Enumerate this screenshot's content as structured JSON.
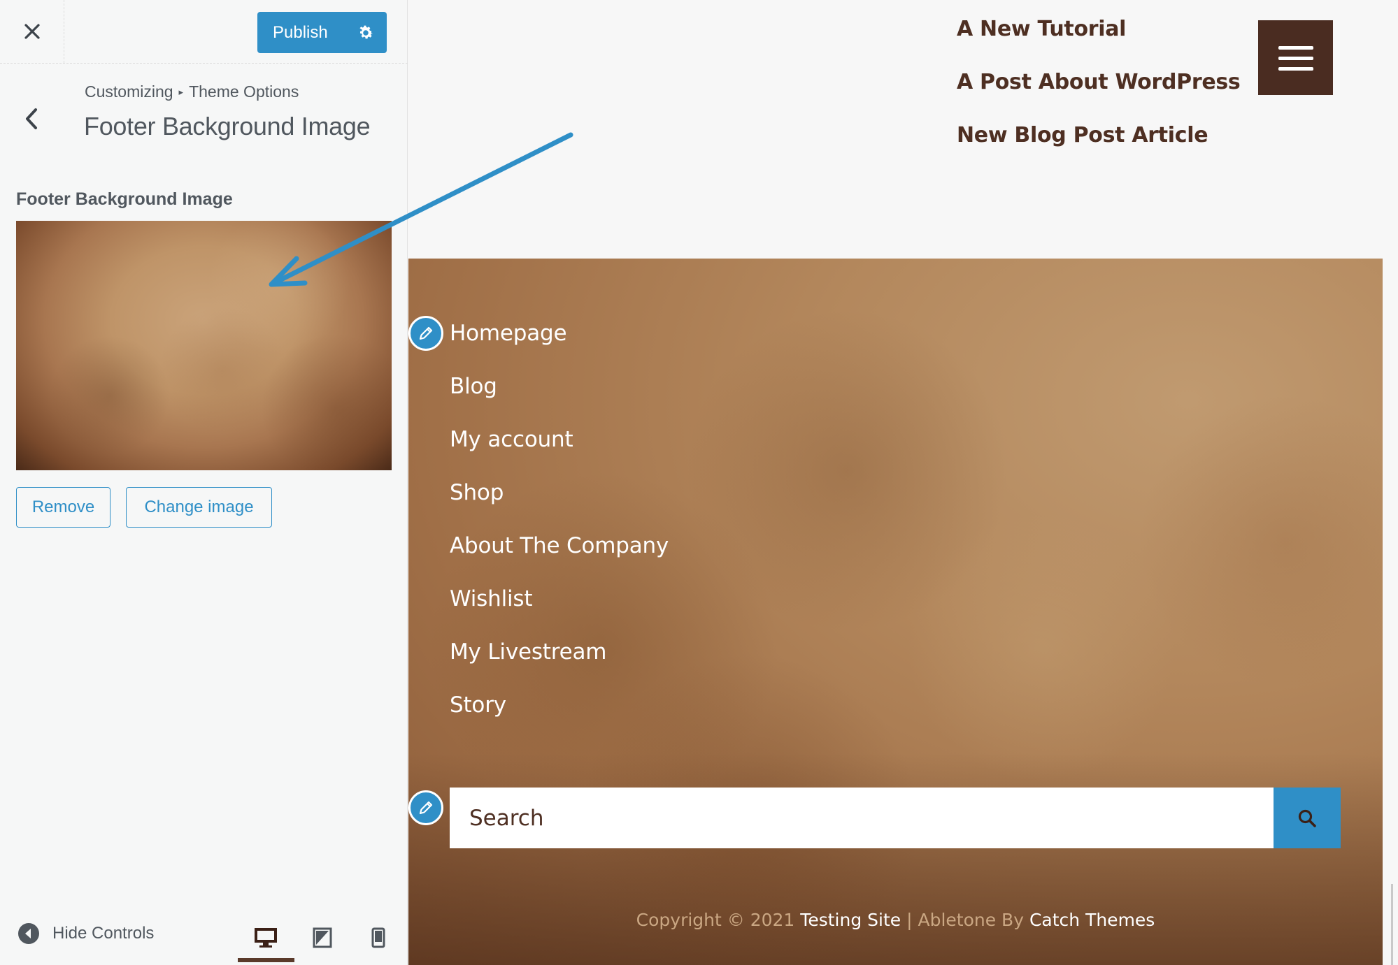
{
  "customizer": {
    "publish_label": "Publish",
    "breadcrumb_root": "Customizing",
    "breadcrumb_separator": "▸",
    "breadcrumb_section": "Theme Options",
    "section_title": "Footer Background Image",
    "control_label": "Footer Background Image",
    "remove_label": "Remove",
    "change_image_label": "Change image",
    "hide_controls_label": "Hide Controls",
    "active_device": "desktop"
  },
  "preview": {
    "recent_posts": [
      "A New Tutorial",
      "A Post About WordPress",
      "New Blog Post Article"
    ],
    "footer_menu": [
      "Homepage",
      "Blog",
      "My account",
      "Shop",
      "About The Company",
      "Wishlist",
      "My Livestream",
      "Story"
    ],
    "search_placeholder": "Search",
    "copyright": {
      "prefix": "Copyright © 2021",
      "site_name": "Testing Site",
      "separator": "|",
      "theme_text": "Abletone By",
      "theme_author": "Catch Themes"
    }
  },
  "colors": {
    "accent": "#2f8fc7",
    "brand_dark": "#4a2c21",
    "text_gray": "#50575e"
  },
  "icons": [
    "close-icon",
    "gear-icon",
    "chevron-left-icon",
    "hamburger-icon",
    "pencil-icon",
    "search-icon",
    "arrow-left-circle-icon",
    "desktop-icon",
    "tablet-icon",
    "mobile-icon"
  ]
}
